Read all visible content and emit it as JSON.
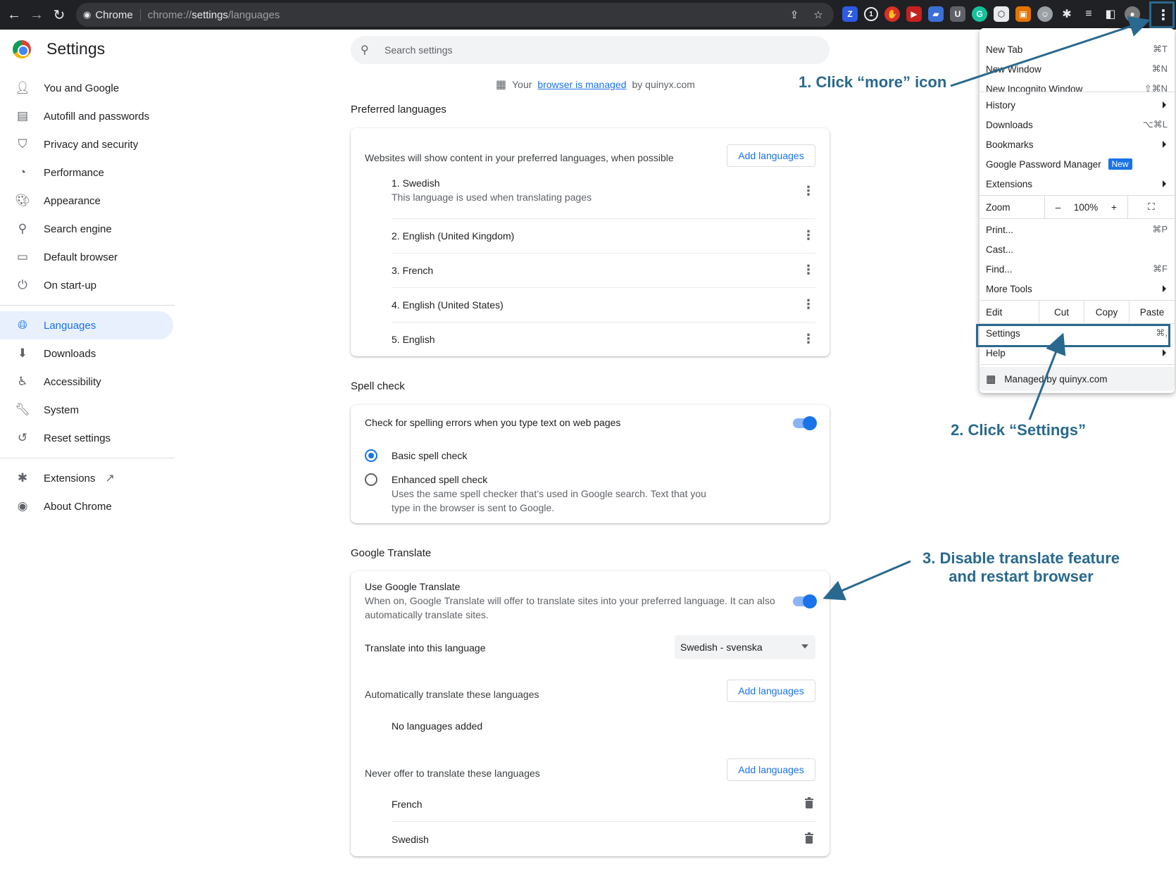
{
  "browser": {
    "site_chip": "Chrome",
    "url_prefix": "chrome://",
    "url_bold": "settings",
    "url_suffix": "/languages"
  },
  "settings": {
    "title": "Settings",
    "search_placeholder": "Search settings",
    "managed": {
      "prefix": "Your",
      "link": "browser is managed",
      "suffix": "by quinyx.com"
    }
  },
  "sidebar": {
    "items": [
      {
        "label": "You and Google",
        "icon": "person-icon"
      },
      {
        "label": "Autofill and passwords",
        "icon": "clipboard-icon"
      },
      {
        "label": "Privacy and security",
        "icon": "shield-icon"
      },
      {
        "label": "Performance",
        "icon": "speedometer-icon"
      },
      {
        "label": "Appearance",
        "icon": "palette-icon"
      },
      {
        "label": "Search engine",
        "icon": "search-icon"
      },
      {
        "label": "Default browser",
        "icon": "browser-icon"
      },
      {
        "label": "On start-up",
        "icon": "power-icon"
      },
      {
        "label": "Languages",
        "icon": "globe-icon",
        "active": true
      },
      {
        "label": "Downloads",
        "icon": "download-icon"
      },
      {
        "label": "Accessibility",
        "icon": "accessibility-icon"
      },
      {
        "label": "System",
        "icon": "wrench-icon"
      },
      {
        "label": "Reset settings",
        "icon": "history-icon"
      },
      {
        "label": "Extensions",
        "icon": "puzzle-icon"
      },
      {
        "label": "About Chrome",
        "icon": "chrome-icon"
      }
    ]
  },
  "preferred": {
    "title": "Preferred languages",
    "description": "Websites will show content in your preferred languages, when possible",
    "add_button": "Add languages",
    "languages": [
      {
        "name": "1. Swedish",
        "note": "This language is used when translating pages"
      },
      {
        "name": "2. English (United Kingdom)"
      },
      {
        "name": "3. French"
      },
      {
        "name": "4. English (United States)"
      },
      {
        "name": "5. English"
      }
    ]
  },
  "spell": {
    "title": "Spell check",
    "toggle_label": "Check for spelling errors when you type text on web pages",
    "basic": "Basic spell check",
    "enhanced": "Enhanced spell check",
    "enhanced_desc_1": "Uses the same spell checker that’s used in Google search. Text that you",
    "enhanced_desc_2": "type in the browser is sent to Google."
  },
  "translate": {
    "title": "Google Translate",
    "use_label": "Use Google Translate",
    "use_desc_1": "When on, Google Translate will offer to translate sites into your preferred language. It can also",
    "use_desc_2": "automatically translate sites.",
    "target_label": "Translate into this language",
    "target_value": "Swedish - svenska",
    "auto_label": "Automatically translate these languages",
    "auto_button": "Add languages",
    "auto_empty": "No languages added",
    "never_label": "Never offer to translate these languages",
    "never_button": "Add languages",
    "never_list": [
      "French",
      "Swedish"
    ]
  },
  "menu": {
    "new_tab": "New Tab",
    "new_tab_sc": "⌘T",
    "new_window": "New Window",
    "new_window_sc": "⌘N",
    "incognito": "New Incognito Window",
    "incognito_sc": "⇧⌘N",
    "history": "History",
    "downloads": "Downloads",
    "downloads_sc": "⌥⌘L",
    "bookmarks": "Bookmarks",
    "password_manager": "Google Password Manager",
    "new_badge": "New",
    "extensions": "Extensions",
    "zoom": "Zoom",
    "zoom_minus": "–",
    "zoom_value": "100%",
    "zoom_plus": "+",
    "print": "Print...",
    "print_sc": "⌘P",
    "cast": "Cast...",
    "find": "Find...",
    "find_sc": "⌘F",
    "more_tools": "More Tools",
    "edit": "Edit",
    "cut": "Cut",
    "copy": "Copy",
    "paste": "Paste",
    "settings": "Settings",
    "settings_sc": "⌘,",
    "help": "Help",
    "managed": "Managed by quinyx.com"
  },
  "annotations": {
    "step1": "1. Click “more” icon",
    "step2": "2. Click “Settings”",
    "step3_line1": "3. Disable translate feature",
    "step3_line2": "and restart browser"
  },
  "colors": {
    "accent": "#1a73e8",
    "annotation": "#29698f",
    "topbar": "#202124"
  }
}
